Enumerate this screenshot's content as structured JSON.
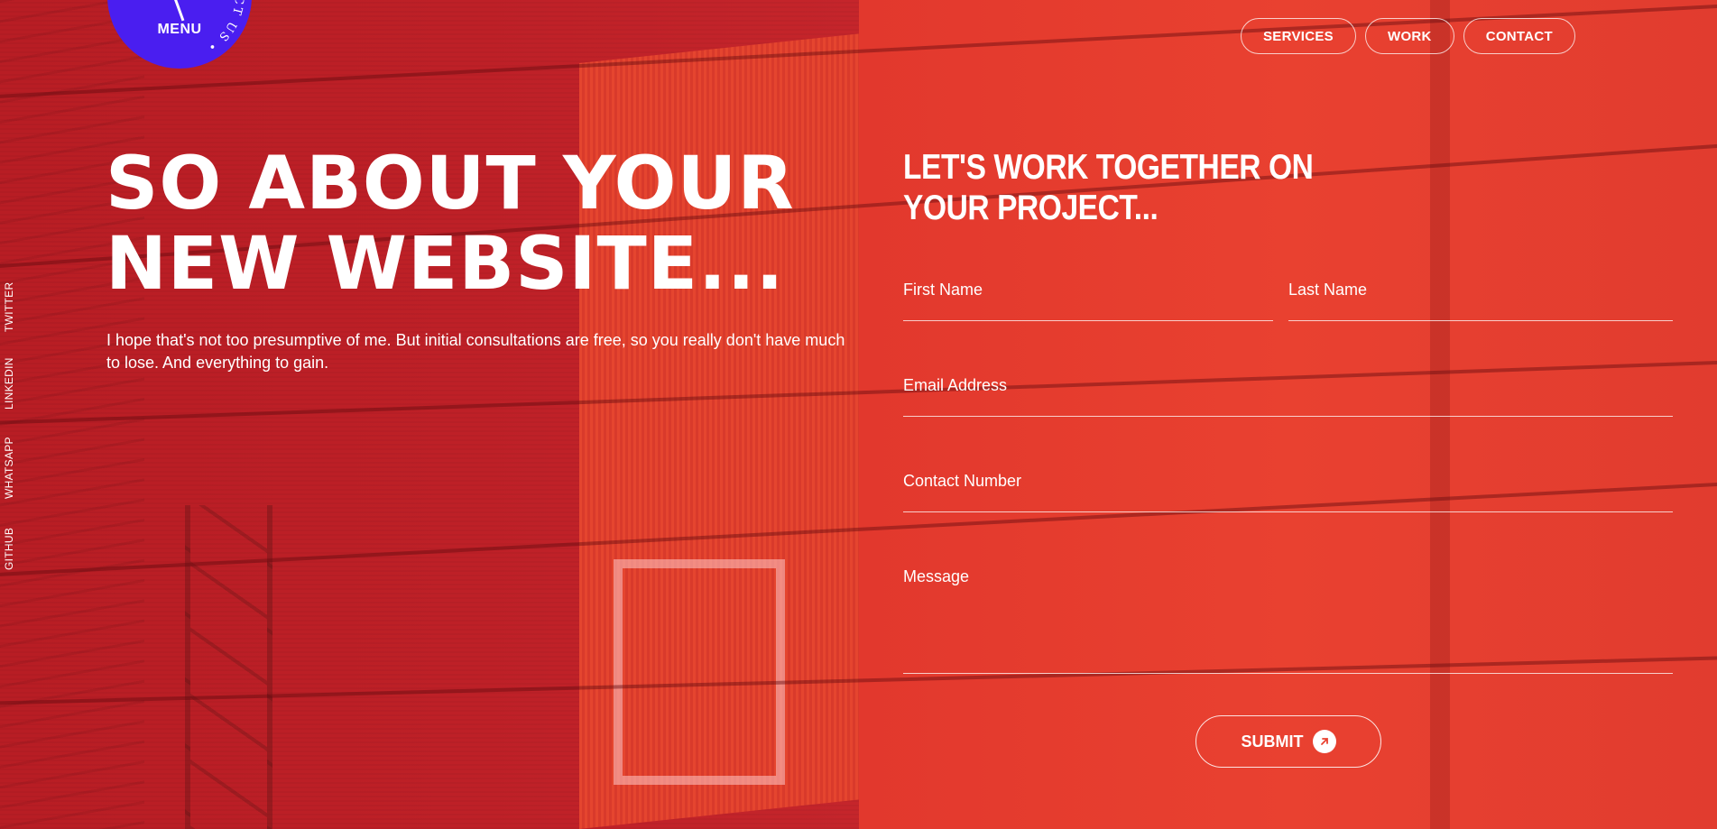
{
  "menu": {
    "label": "MENU",
    "ring_text": "CONTACT US • CONTACT US •"
  },
  "nav": {
    "items": [
      {
        "label": "SERVICES"
      },
      {
        "label": "WORK"
      },
      {
        "label": "CONTACT"
      }
    ]
  },
  "social": {
    "items": [
      {
        "label": "TWITTER"
      },
      {
        "label": "LINKEDIN"
      },
      {
        "label": "WHATSAPP"
      },
      {
        "label": "GITHUB"
      }
    ]
  },
  "hero": {
    "title_line1": "SO ABOUT YOUR",
    "title_line2": "NEW WEBSITE...",
    "body": "I hope that's not too presumptive of me. But initial consultations are free, so you really don't have much to lose. And everything to gain."
  },
  "form": {
    "title_line1": "LET'S WORK TOGETHER ON",
    "title_line2": "YOUR PROJECT...",
    "first_name": "First Name",
    "last_name": "Last Name",
    "email": "Email Address",
    "phone": "Contact Number",
    "message": "Message",
    "submit": "SUBMIT"
  },
  "colors": {
    "left_panel": "#be2027",
    "right_panel": "#e94130",
    "menu_badge": "#4a1ef0",
    "text": "#ffffff"
  },
  "icons": {
    "submit": "arrow-up-right-icon"
  }
}
